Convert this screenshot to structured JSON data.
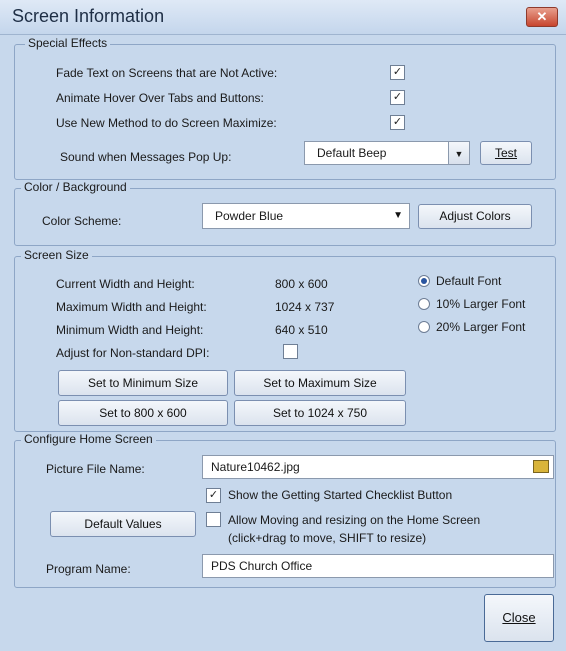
{
  "window": {
    "title": "Screen Information",
    "close_glyph": "✕"
  },
  "special_effects": {
    "legend": "Special Effects",
    "fade_text": {
      "label": "Fade Text on Screens that are Not Active:",
      "checked": true
    },
    "animate_hover": {
      "label": "Animate Hover Over Tabs and Buttons:",
      "checked": true
    },
    "new_maximize": {
      "label": "Use New Method to do Screen Maximize:",
      "checked": true
    },
    "sound_label": "Sound when Messages Pop Up:",
    "sound_value": "Default Beep",
    "test_button": "Test"
  },
  "color_background": {
    "legend": "Color / Background",
    "scheme_label": "Color Scheme:",
    "scheme_value": "Powder Blue",
    "adjust_button": "Adjust Colors"
  },
  "screen_size": {
    "legend": "Screen Size",
    "current_label": "Current Width and Height:",
    "current_value": "800 x 600",
    "max_label": "Maximum Width and Height:",
    "max_value": "1024 x 737",
    "min_label": "Minimum Width and Height:",
    "min_value": "640 x 510",
    "dpi_label": "Adjust for Non-standard DPI:",
    "dpi_checked": false,
    "font_options": [
      "Default Font",
      "10% Larger Font",
      "20% Larger Font"
    ],
    "selected_font": "Default Font",
    "btn_min": "Set to Minimum Size",
    "btn_max": "Set to Maximum Size",
    "btn_800": "Set to 800 x 600",
    "btn_1024": "Set to 1024 x 750"
  },
  "home_screen": {
    "legend": "Configure Home Screen",
    "picture_label": "Picture File Name:",
    "picture_value": "Nature10462.jpg",
    "show_checklist": {
      "label": "Show the Getting Started Checklist Button",
      "checked": true
    },
    "allow_moving": {
      "label": "Allow Moving and resizing on the Home Screen",
      "checked": false
    },
    "allow_moving_hint": "(click+drag to move, SHIFT to resize)",
    "default_values_button": "Default Values",
    "program_label": "Program Name:",
    "program_value": "PDS Church Office"
  },
  "footer": {
    "close_button": "Close"
  },
  "icons": {
    "checkbox_check": "✓",
    "dropdown_arrow": "▼",
    "folder": "folder-open-icon"
  },
  "colors": {
    "background": "#c7d8ec",
    "close_red": "#c7452e"
  }
}
